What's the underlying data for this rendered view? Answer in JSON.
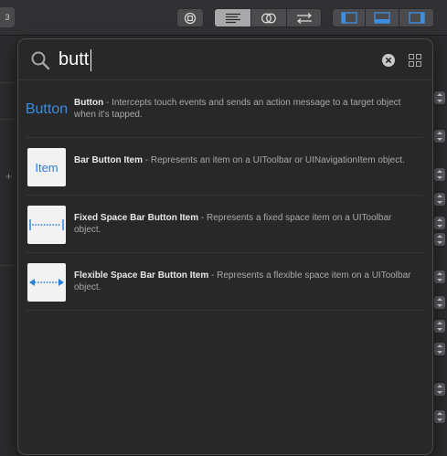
{
  "toolbar": {
    "tab_badge": "3",
    "icons": [
      "stop-icon",
      "editor-standard-icon",
      "editor-assistant-icon",
      "editor-version-icon",
      "navigator-panel-icon",
      "debug-panel-icon",
      "utilities-panel-icon"
    ]
  },
  "library": {
    "search": {
      "value": "butt",
      "placeholder": ""
    },
    "results": [
      {
        "thumb_label": "Button",
        "title": "Button",
        "description": " - Intercepts touch events and sends an action message to a target object when it's tapped."
      },
      {
        "thumb_label": "Item",
        "title": "Bar Button Item",
        "description": " - Represents an item on a UIToolbar or UINavigationItem object."
      },
      {
        "thumb_label": "",
        "title": "Fixed Space Bar Button Item",
        "description": " - Represents a fixed space item on a UIToolbar object."
      },
      {
        "thumb_label": "",
        "title": "Flexible Space Bar Button Item",
        "description": " - Represents a flexible space item on a UIToolbar object."
      }
    ]
  },
  "colors": {
    "accent": "#2a7fd4",
    "popover_bg": "#282829",
    "toolbar_bg": "#313133"
  }
}
